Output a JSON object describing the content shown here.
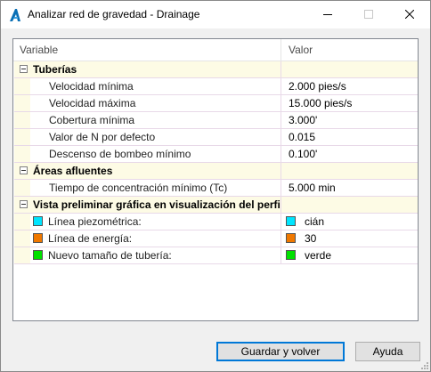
{
  "window": {
    "title": "Analizar red de gravedad - Drainage",
    "icon": "autodesk-civil-icon"
  },
  "grid": {
    "headers": {
      "variable": "Variable",
      "value": "Valor"
    },
    "categories": [
      {
        "label": "Tuberías",
        "rows": [
          {
            "label": "Velocidad mínima",
            "value": "2.000 pies/s"
          },
          {
            "label": "Velocidad máxima",
            "value": "15.000 pies/s"
          },
          {
            "label": "Cobertura mínima",
            "value": "3.000'"
          },
          {
            "label": "Valor de N por defecto",
            "value": "0.015"
          },
          {
            "label": "Descenso de bombeo mínimo",
            "value": "0.100'"
          }
        ]
      },
      {
        "label": "Áreas afluentes",
        "rows": [
          {
            "label": "Tiempo de concentración mínimo (Tc)",
            "value": "5.000 min"
          }
        ]
      },
      {
        "label": "Vista preliminar gráfica en visualización del perfil",
        "rows": [
          {
            "label": "Línea piezométrica:",
            "value": "cián",
            "color": "#00e5ff"
          },
          {
            "label": "Línea de energía:",
            "value": "30",
            "color": "#f07800"
          },
          {
            "label": "Nuevo tamaño de tubería:",
            "value": "verde",
            "color": "#00e000"
          }
        ]
      }
    ]
  },
  "buttons": {
    "save": "Guardar y volver",
    "help": "Ayuda"
  }
}
